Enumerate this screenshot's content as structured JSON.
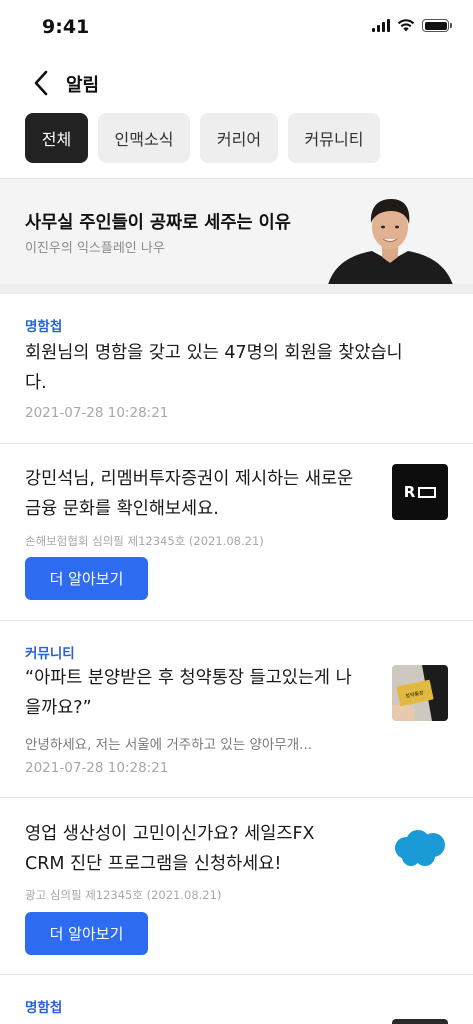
{
  "status_bar": {
    "time": "9:41"
  },
  "header": {
    "title": "알림"
  },
  "tabs": [
    {
      "label": "전체",
      "active": true
    },
    {
      "label": "인맥소식",
      "active": false
    },
    {
      "label": "커리어",
      "active": false
    },
    {
      "label": "커뮤니티",
      "active": false
    }
  ],
  "banner": {
    "title": "사무실 주인들이 공짜로 세주는 이유",
    "subtitle": "이진우의 익스플레인 나우"
  },
  "notifications": [
    {
      "category": "명함첩",
      "text_lines": [
        "회원님의 명함을 갖고 있는 47명의 회원을 찾았습니",
        "다."
      ],
      "time": "2021-07-28 10:28:21"
    },
    {
      "text_lines": [
        "강민석님, 리멤버투자증권이 제시하는 새로운",
        "금융 문화를 확인해보세요."
      ],
      "meta": "손해보험협회 심의필 제12345호 (2021.08.21)",
      "button": "더 알아보기",
      "thumb_text": "R",
      "thumb_icon": "remember-logo-icon"
    },
    {
      "category": "커뮤니티",
      "text_lines": [
        "“아파트 분양받은 후 청약통장 들고있는게 나",
        "을까요?”"
      ],
      "preview": "안녕하세요, 저는 서울에 거주하고 있는 양아무개...",
      "time": "2021-07-28 10:28:21",
      "thumb_label": "청약통장",
      "thumb_icon": "bankbook-photo-icon"
    },
    {
      "text_lines": [
        "영업 생산성이 고민이신가요? 세일즈FX",
        "CRM 진단 프로그램을 신청하세요!"
      ],
      "meta": "광고 심의필 제12345호 (2021.08.21)",
      "button": "더 알아보기",
      "thumb_icon": "salesforce-cloud-icon"
    },
    {
      "category": "명함첩"
    }
  ],
  "colors": {
    "accent": "#2d6cf0",
    "category": "#2a62d9",
    "tab_active": "#222222",
    "tab_inactive": "#eeeeee"
  }
}
